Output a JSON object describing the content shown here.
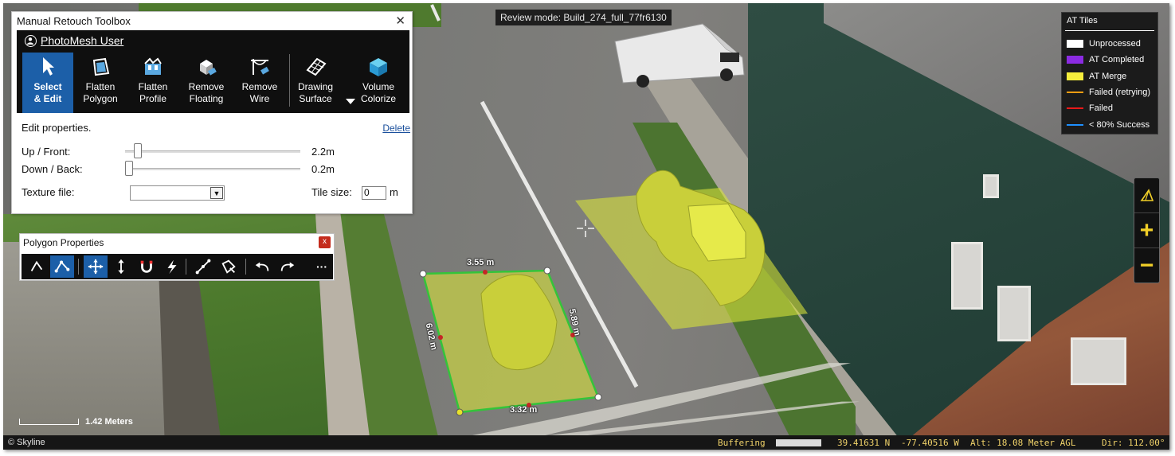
{
  "review_mode": "Review mode: Build_274_full_77fr6130",
  "toolbox": {
    "title": "Manual Retouch Toolbox",
    "close_glyph": "✕",
    "user": "PhotoMesh User",
    "tools": [
      {
        "label": "Select\n& Edit",
        "icon": "pointer-icon",
        "active": true
      },
      {
        "label": "Flatten\nPolygon",
        "icon": "flatten-polygon-icon",
        "active": false
      },
      {
        "label": "Flatten\nProfile",
        "icon": "flatten-profile-icon",
        "active": false
      },
      {
        "label": "Remove\nFloating",
        "icon": "remove-floating-icon",
        "active": false
      },
      {
        "label": "Remove\nWire",
        "icon": "remove-wire-icon",
        "active": false
      },
      {
        "label": "Drawing\nSurface",
        "icon": "drawing-surface-icon",
        "active": false
      },
      {
        "label": "Volume\nColorize",
        "icon": "volume-colorize-icon",
        "active": false
      }
    ],
    "edit_properties": "Edit properties.",
    "delete_link": "Delete",
    "up_front_label": "Up / Front:",
    "up_front_value": "2.2m",
    "up_front_slider": 0.05,
    "down_back_label": "Down / Back:",
    "down_back_value": "0.2m",
    "down_back_slider": 0.0,
    "texture_label": "Texture file:",
    "texture_value": "",
    "tile_size_label": "Tile size:",
    "tile_size_value": "0",
    "tile_size_unit": "m"
  },
  "polygon_properties": {
    "title": "Polygon Properties",
    "close_glyph": "x",
    "tools": [
      "undo-curve-icon",
      "edit-vertices-icon",
      "move-icon",
      "vertical-move-icon",
      "snap-magnet-icon",
      "split-icon",
      "add-vertex-icon",
      "delete-vertex-icon",
      "undo-icon",
      "redo-icon",
      "more-icon"
    ],
    "more_glyph": "···"
  },
  "at_legend": {
    "title": "AT Tiles",
    "items": [
      {
        "label": "Unprocessed",
        "color": "#ffffff",
        "kind": "box"
      },
      {
        "label": "AT Completed",
        "color": "#8b2be2",
        "kind": "box"
      },
      {
        "label": "AT Merge",
        "color": "#f6ee3c",
        "kind": "box"
      },
      {
        "label": "Failed (retrying)",
        "color": "#f39c12",
        "kind": "line"
      },
      {
        "label": "Failed",
        "color": "#e81919",
        "kind": "line"
      },
      {
        "label": "< 80% Success",
        "color": "#1e90ff",
        "kind": "line"
      }
    ]
  },
  "measurements": {
    "top": "3.55 m",
    "right": "5.89 m",
    "left": "6.02 m",
    "bottom": "3.32 m"
  },
  "scale_label": "1.42 Meters",
  "status": {
    "copyright": "© Skyline",
    "buffering": "Buffering",
    "lat": "39.41631 N",
    "lon": "-77.40516 W",
    "alt": "Alt: 18.08 Meter AGL",
    "dir": "Dir: 112.00°"
  },
  "nav": {
    "zoom_in": "+",
    "zoom_out": "−"
  },
  "colors": {
    "accent": "#1c5fa8",
    "selection": "#d7e23a",
    "polygon_edge": "#34c43a"
  }
}
